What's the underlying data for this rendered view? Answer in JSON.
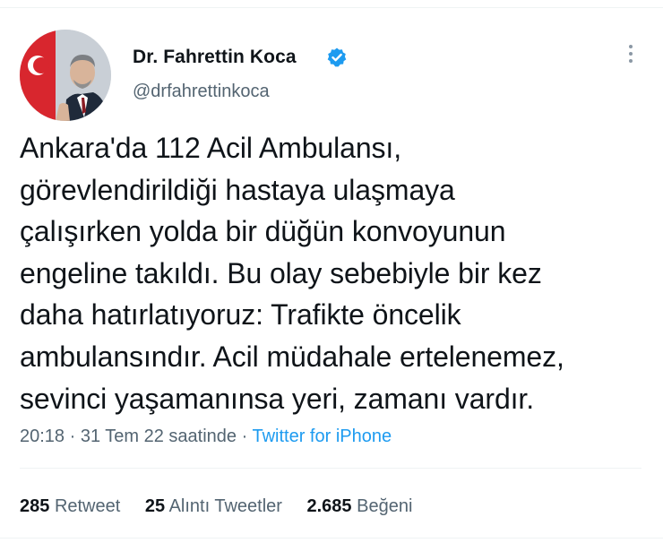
{
  "author": {
    "name": "Dr. Fahrettin Koca",
    "handle": "@drfahrettinkoca",
    "verified": true,
    "avatar_icon": "profile-photo"
  },
  "tweet": {
    "text": "Ankara'da 112 Acil Ambulansı,\ngörevlendirildiği hastaya ulaşmaya\nçalışırken yolda bir düğün konvoyunun\nengeline takıldı. Bu olay sebebiyle bir kez\ndaha hatırlatıyoruz: Trafikte öncelik\nambulansındır. Acil müdahale ertelenemez,\nsevinci yaşamanınsa yeri, zamanı vardır."
  },
  "meta": {
    "time": "20:18",
    "separator": " · ",
    "date": "31 Tem 22 saatinde",
    "source": "Twitter for iPhone"
  },
  "stats": {
    "retweets_count": "285",
    "retweets_label": "Retweet",
    "quotes_count": "25",
    "quotes_label": "Alıntı Tweetler",
    "likes_count": "2.685",
    "likes_label": "Beğeni"
  },
  "colors": {
    "text": "#0f1419",
    "secondary": "#536471",
    "accent": "#1d9bf0"
  }
}
